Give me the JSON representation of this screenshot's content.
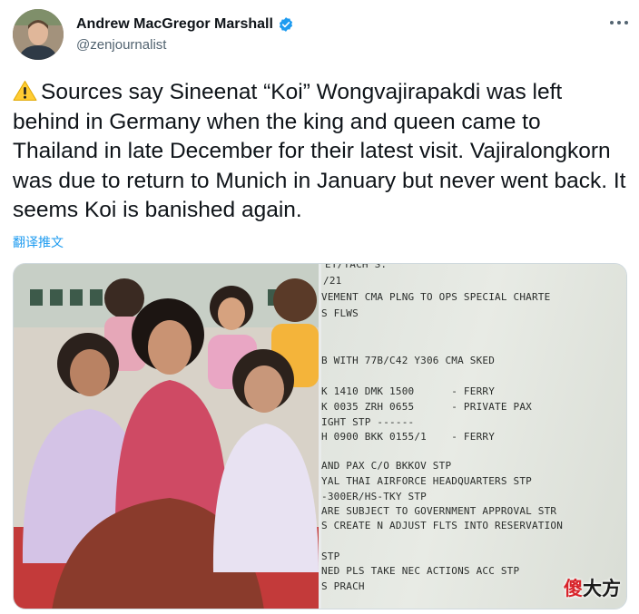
{
  "author": {
    "display_name": "Andrew MacGregor Marshall",
    "handle": "@zenjournalist",
    "verified": true
  },
  "tweet": {
    "text": "Sources say Sineenat “Koi” Wongvajirapakdi was left behind in Germany when the king and queen came to Thailand in late December for their latest visit. Vajiralongkorn was due to return to Munich in January but never went back. It seems Koi is banished again.",
    "translate_label": "翻译推文",
    "leading_icon": "warning-icon"
  },
  "media": {
    "document_lines": [
      "/21",
      "VEMENT CMA PLNG TO OPS SPECIAL CHARTE",
      "S FLWS",
      "B WITH 77B/C42 Y306 CMA SKED",
      "K 1410 DMK 1500      - FERRY",
      "K 0035 ZRH 0655      - PRIVATE PAX",
      "IGHT STP ------",
      "H 0900 BKK 0155/1    - FERRY",
      "AND PAX C/O BKKOV STP",
      "YAL THAI AIRFORCE HEADQUARTERS STP",
      "-300ER/HS-TKY STP",
      "ARE SUBJECT TO GOVERNMENT APPROVAL STR",
      "S CREATE N ADJUST FLTS INTO RESERVATION",
      "STP",
      "NED PLS TAKE NEC ACTIONS ACC STP",
      "S PRACH"
    ],
    "watermark_red": "傻",
    "watermark_dark": "大方"
  },
  "colors": {
    "link": "#1d9bf0",
    "verified": "#1d9bf0",
    "secondary_text": "#536471",
    "primary_text": "#0f1419"
  }
}
